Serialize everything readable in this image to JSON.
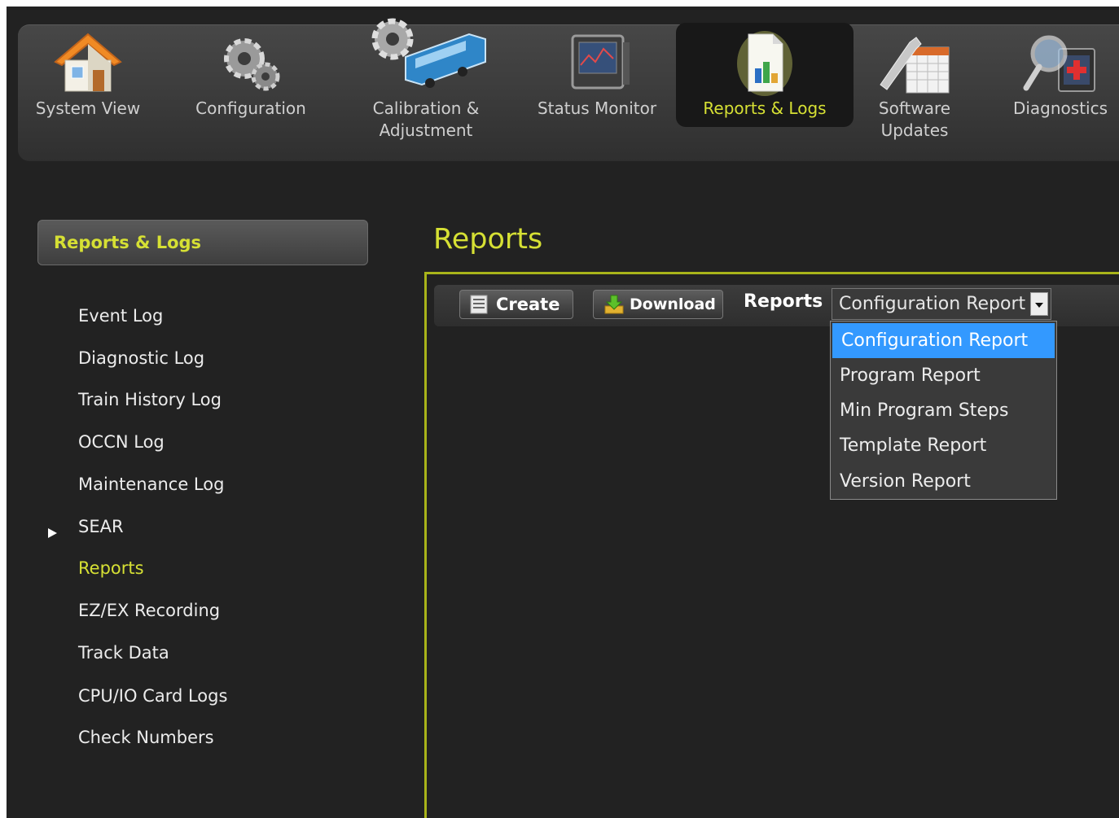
{
  "nav": {
    "items": [
      {
        "label": "System View",
        "icon": "house-icon"
      },
      {
        "label": "Configuration",
        "icon": "gears-icon"
      },
      {
        "label1": "Calibration &",
        "label2": "Adjustment",
        "icon": "gear-train-icon"
      },
      {
        "label": "Status Monitor",
        "icon": "monitor-icon"
      },
      {
        "label": "Reports & Logs",
        "icon": "report-document-icon"
      },
      {
        "label1": "Software",
        "label2": "Updates",
        "icon": "wrench-calendar-icon"
      },
      {
        "label": "Diagnostics",
        "icon": "magnifier-medical-icon"
      }
    ],
    "active_index": 4
  },
  "sidebar": {
    "header": "Reports & Logs",
    "items": [
      {
        "label": "Event Log"
      },
      {
        "label": "Diagnostic Log"
      },
      {
        "label": "Train History Log"
      },
      {
        "label": "OCCN Log"
      },
      {
        "label": "Maintenance Log"
      },
      {
        "label": "SEAR"
      },
      {
        "label": "Reports"
      },
      {
        "label": "EZ/EX Recording"
      },
      {
        "label": "Track Data"
      },
      {
        "label": "CPU/IO Card Logs"
      },
      {
        "label": "Check Numbers"
      }
    ]
  },
  "main": {
    "title": "Reports",
    "toolbar": {
      "create_label": "Create",
      "download_label": "Download",
      "reports_label": "Reports",
      "select_value": "Configuration Report"
    },
    "dropdown_options": [
      "Configuration Report",
      "Program Report",
      "Min Program Steps",
      "Template Report",
      "Version Report"
    ]
  },
  "colors": {
    "accent": "#d6e034",
    "panel_border": "#a9b41a",
    "selection": "#3399ff",
    "background": "#222222"
  }
}
